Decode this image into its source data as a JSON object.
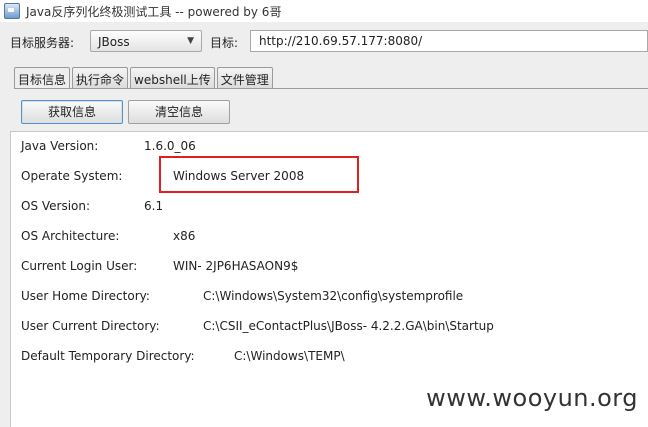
{
  "window": {
    "title": "Java反序列化终极测试工具  -- powered by 6哥"
  },
  "toolbar": {
    "server_label": "目标服务器:",
    "server_value": "JBoss",
    "target_label": "目标:",
    "target_url": "http://210.69.57.177:8080/"
  },
  "tabs": [
    {
      "label": "目标信息",
      "active": true
    },
    {
      "label": "执行命令",
      "active": false
    },
    {
      "label": "webshell上传",
      "active": false
    },
    {
      "label": "文件管理",
      "active": false
    }
  ],
  "buttons": {
    "get_info": "获取信息",
    "clear_info": "清空信息"
  },
  "info": [
    {
      "label": "Java Version:",
      "value": "1.6.0_06"
    },
    {
      "label": "Operate System:",
      "value": "Windows Server 2008"
    },
    {
      "label": "OS Version:",
      "value": "6.1"
    },
    {
      "label": "OS Architecture:",
      "value": "x86"
    },
    {
      "label": "Current Login User:",
      "value": "WIN- 2JP6HASAON9$"
    },
    {
      "label": "User Home Directory:",
      "value": "C:\\Windows\\System32\\config\\systemprofile"
    },
    {
      "label": "User Current Directory:",
      "value": "C:\\CSII_eContactPlus\\JBoss- 4.2.2.GA\\bin\\Startup"
    },
    {
      "label": "Default Temporary Directory:",
      "value": "C:\\Windows\\TEMP\\"
    }
  ],
  "highlight_color": "#e02020",
  "watermark": "www.wooyun.org"
}
